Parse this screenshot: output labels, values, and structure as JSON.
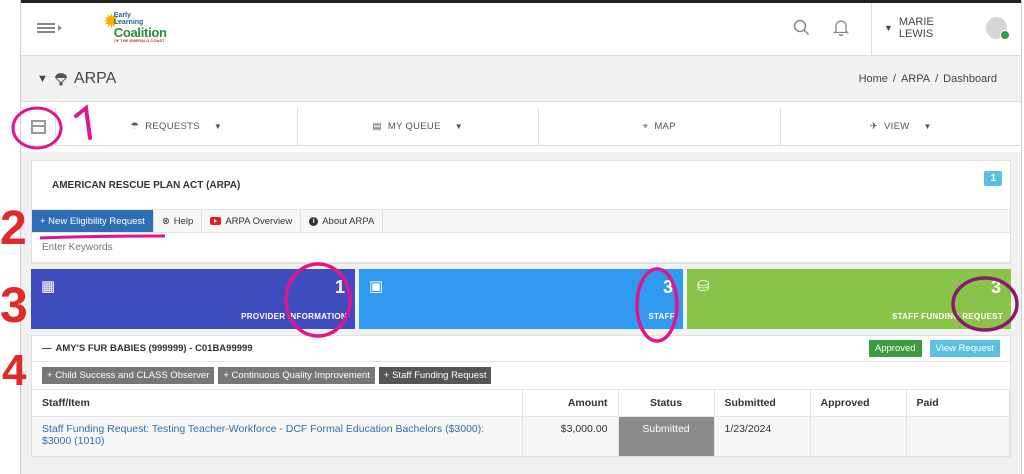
{
  "header": {
    "logo": {
      "line1": "Early",
      "line2": "Learning",
      "line3": "Coalition",
      "line4": "OF THE EMERALD COAST"
    },
    "user_name": "MARIE LEWIS"
  },
  "titlebar": {
    "title": "ARPA",
    "breadcrumb": [
      "Home",
      "/",
      "ARPA",
      "/",
      "Dashboard"
    ]
  },
  "subnav": {
    "items": [
      "REQUESTS",
      "MY QUEUE",
      "MAP",
      "VIEW"
    ]
  },
  "panel": {
    "title": "AMERICAN RESCUE PLAN ACT (ARPA)",
    "badge": "1",
    "tabs": {
      "new_request": "+ New Eligibility Request",
      "help": "Help",
      "overview": "ARPA Overview",
      "about": "About ARPA"
    },
    "search_placeholder": "Enter Keywords"
  },
  "stats": [
    {
      "label": "PROVIDER INFORMATION",
      "value": "1",
      "color": "#3f4cbf",
      "icon": "building-icon"
    },
    {
      "label": "STAFF",
      "value": "3",
      "color": "#2f9af0",
      "icon": "id-card-icon"
    },
    {
      "label": "STAFF FUNDING REQUEST",
      "value": "3",
      "color": "#8ac349",
      "icon": "coins-icon"
    }
  ],
  "provider": {
    "name": "AMY'S FUR BABIES (999999) - C01BA99999",
    "status": "Approved",
    "view_label": "View Request",
    "actions": [
      "+ Child Success and CLASS Observer",
      "+ Continuous Quality Improvement",
      "+ Staff Funding Request"
    ],
    "table": {
      "headers": [
        "Staff/Item",
        "Amount",
        "Status",
        "Submitted",
        "Approved",
        "Paid"
      ],
      "rows": [
        {
          "item": "Staff Funding Request: Testing Teacher-Workforce - DCF Formal Education Bachelors ($3000): $3000 (1010)",
          "amount": "$3,000.00",
          "status": "Submitted",
          "submitted": "1/23/2024",
          "approved": "",
          "paid": ""
        }
      ]
    }
  },
  "annotations": [
    "1",
    "2",
    "3",
    "4"
  ]
}
